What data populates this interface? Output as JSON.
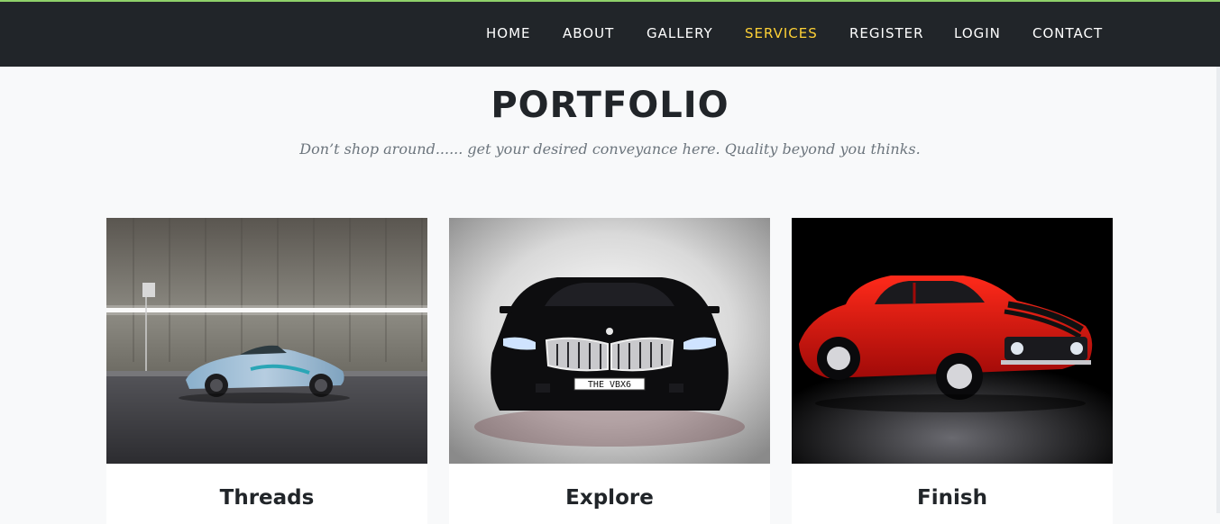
{
  "nav": {
    "items": [
      {
        "label": "HOME",
        "active": false
      },
      {
        "label": "ABOUT",
        "active": false
      },
      {
        "label": "GALLERY",
        "active": false
      },
      {
        "label": "SERVICES",
        "active": true
      },
      {
        "label": "REGISTER",
        "active": false
      },
      {
        "label": "LOGIN",
        "active": false
      },
      {
        "label": "CONTACT",
        "active": false
      }
    ]
  },
  "portfolio": {
    "title": "PORTFOLIO",
    "subtitle": "Don’t shop around...... get your desired conveyance here. Quality beyond you thinks.",
    "cards": [
      {
        "caption": "Threads",
        "image": "silver-sports-car-in-tunnel"
      },
      {
        "caption": "Explore",
        "image": "black-bmw-suv-front"
      },
      {
        "caption": "Finish",
        "image": "red-muscle-car"
      }
    ],
    "plate_text": "THE VBX6"
  },
  "colors": {
    "navbar": "#212529",
    "accent": "#fed136",
    "topline": "#8fd16a"
  }
}
